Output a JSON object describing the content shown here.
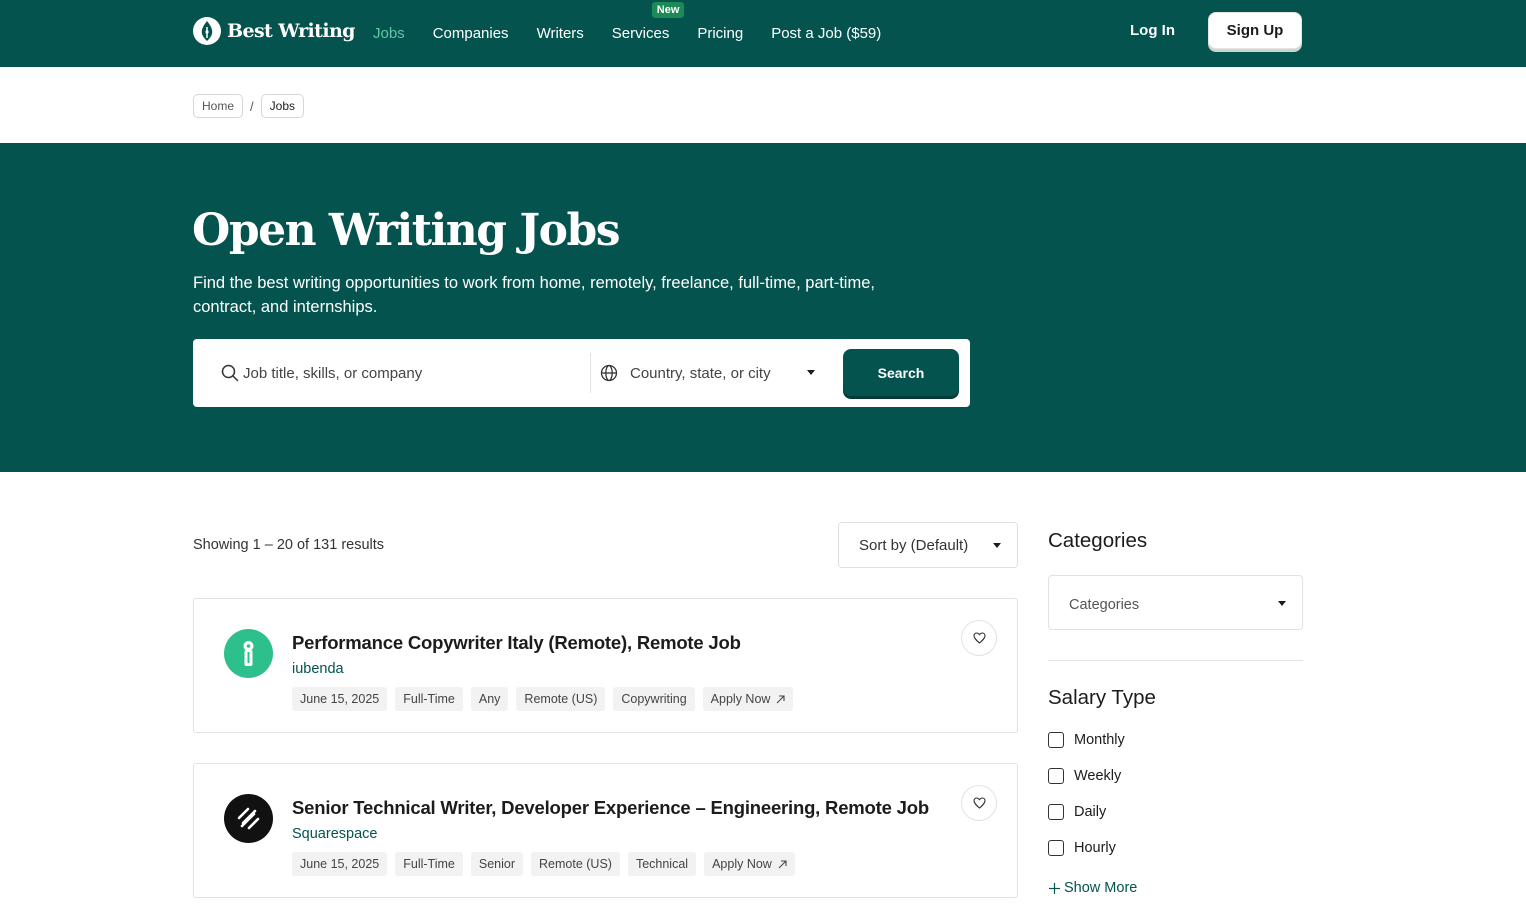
{
  "header": {
    "logo_text": "Best Writing",
    "nav": [
      {
        "label": "Jobs",
        "active": true
      },
      {
        "label": "Companies"
      },
      {
        "label": "Writers"
      },
      {
        "label": "Services",
        "badge": "New"
      },
      {
        "label": "Pricing"
      },
      {
        "label": "Post a Job ($59)"
      }
    ],
    "login_label": "Log In",
    "signup_label": "Sign Up"
  },
  "breadcrumb": [
    "Home",
    "Jobs"
  ],
  "hero": {
    "title": "Open Writing Jobs",
    "subtitle": "Find the best writing opportunities to work from home, remotely, freelance, full-time, part-time, contract, and internships.",
    "search_placeholder": "Job title, skills, or company",
    "location_placeholder": "Country, state, or city",
    "search_button": "Search"
  },
  "results": {
    "count_text": "Showing 1 – 20 of 131 results",
    "sort_label": "Sort by (Default)"
  },
  "jobs": [
    {
      "title": "Performance Copywriter Italy (Remote), Remote Job",
      "company": "iubenda",
      "logo_icon": "iubenda-logo-icon",
      "logo_color": "#2dc08d",
      "tags": [
        "June 15, 2025",
        "Full-Time",
        "Any",
        "Remote (US)",
        "Copywriting"
      ],
      "apply_label": "Apply Now"
    },
    {
      "title": "Senior Technical Writer, Developer Experience – Engineering, Remote Job",
      "company": "Squarespace",
      "logo_icon": "squarespace-logo-icon",
      "logo_color": "#111111",
      "tags": [
        "June 15, 2025",
        "Full-Time",
        "Senior",
        "Remote (US)",
        "Technical"
      ],
      "apply_label": "Apply Now"
    }
  ],
  "sidebar": {
    "categories_title": "Categories",
    "categories_placeholder": "Categories",
    "salary_title": "Salary Type",
    "salary_options": [
      "Monthly",
      "Weekly",
      "Daily",
      "Hourly"
    ],
    "show_more": "Show More"
  },
  "colors": {
    "brand": "#04534f",
    "nav_active": "#5fc9a6",
    "badge": "#1b8a57"
  }
}
